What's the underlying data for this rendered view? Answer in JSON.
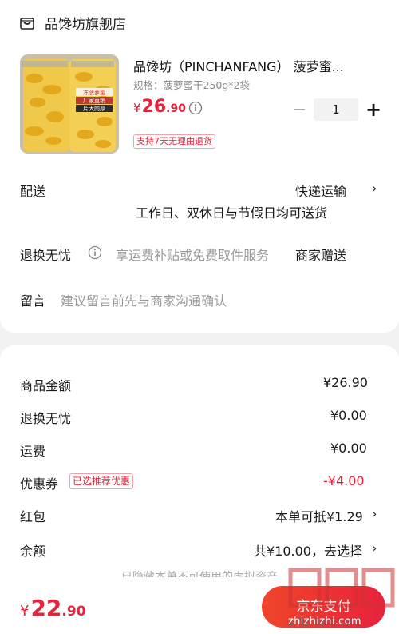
{
  "store": {
    "name": "品馋坊旗舰店",
    "icon": "store-icon"
  },
  "product": {
    "title": "品馋坊（PINCHANFANG） 菠萝蜜...",
    "spec": "规格：菠萝蜜干250g*2袋",
    "price_symbol": "¥",
    "price_int": "26",
    "price_dec": ".90",
    "quantity": "1",
    "minus": "−",
    "plus": "+",
    "return_tag": "支持7天无理由退货",
    "image_labels": {
      "l1": "冻菠萝蜜",
      "l2": "厂家直销",
      "l3": "片大肉厚"
    }
  },
  "delivery": {
    "label": "配送",
    "method": "快递运输",
    "note": "工作日、双休日与节假日均可送货"
  },
  "worry_free": {
    "label": "退换无忧",
    "desc": "享运费补贴或免费取件服务",
    "value": "商家赠送"
  },
  "message": {
    "label": "留言",
    "placeholder": "建议留言前先与商家沟通确认"
  },
  "summary": {
    "goods_label": "商品金额",
    "goods_value": "¥26.90",
    "worry_label": "退换无忧",
    "worry_value": "¥0.00",
    "shipping_label": "运费",
    "shipping_value": "¥0.00",
    "coupon_label": "优惠券",
    "coupon_tag": "已选推荐优惠",
    "coupon_value": "-¥4.00",
    "redpacket_label": "红包",
    "redpacket_value": "本单可抵¥1.29",
    "balance_label": "余额",
    "balance_value": "共¥10.00，去选择"
  },
  "hidden_note": "已隐藏本单不可使用的虚拟资产",
  "footer": {
    "total_symbol": "¥",
    "total_int": "22",
    "total_dec": ".90",
    "pay_label": "京东支付"
  },
  "watermark": {
    "text": "值|什么值得买",
    "url": "zhizhizhi.com"
  },
  "colors": {
    "accent": "#e5233a",
    "background": "#f2f2f2"
  }
}
